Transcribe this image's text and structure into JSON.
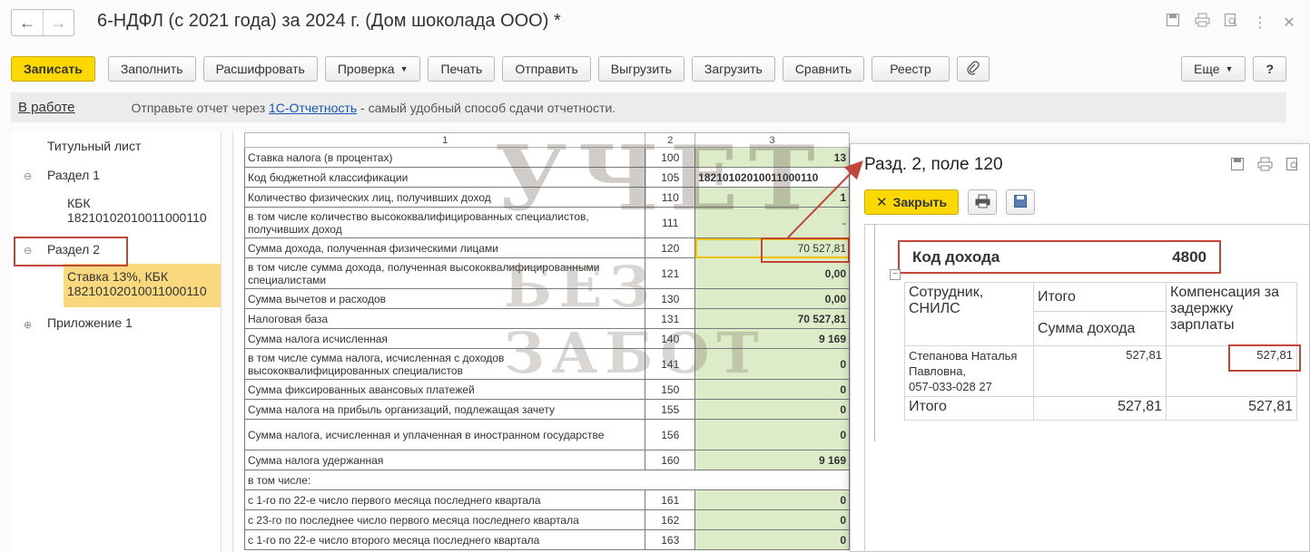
{
  "window": {
    "title": "6-НДФЛ (с 2021 года) за 2024 г. (Дом шоколада ООО) *",
    "back_icon": "←",
    "forward_icon": "→"
  },
  "toolbar": {
    "save": "Записать",
    "fill": "Заполнить",
    "decode": "Расшифровать",
    "check": "Проверка",
    "print": "Печать",
    "send": "Отправить",
    "export": "Выгрузить",
    "import": "Загрузить",
    "compare": "Сравнить",
    "registry": "Реестр",
    "more": "Еще",
    "help": "?"
  },
  "status": {
    "state": "В работе",
    "msg_before": "Отправьте отчет через ",
    "msg_link": "1С-Отчетность",
    "msg_after": " - самый удобный способ сдачи отчетности."
  },
  "tree": {
    "title_sheet": "Титульный лист",
    "section1": "Раздел 1",
    "kbk_line1": "КБК",
    "kbk_line2": "18210102010011000110",
    "section2": "Раздел 2",
    "rate_line1": "Ставка 13%, КБК",
    "rate_line2": "18210102010011000110",
    "appendix1": "Приложение 1"
  },
  "report": {
    "headers": [
      "1",
      "2",
      "3"
    ],
    "rows": [
      {
        "label": "Ставка налога (в процентах)",
        "code": "100",
        "value": "13"
      },
      {
        "label": "Код бюджетной классификации",
        "code": "105",
        "value": "18210102010011000110"
      },
      {
        "label": "Количество физических лиц, получивших доход",
        "code": "110",
        "value": "1"
      },
      {
        "label": "в том числе количество высококвалифицированных специалистов, получивших доход",
        "code": "111",
        "value": "-"
      },
      {
        "label": "Сумма дохода, полученная физическими лицами",
        "code": "120",
        "value": "70 527,81"
      },
      {
        "label": "в том числе сумма дохода, полученная высококвалифицированными специалистами",
        "code": "121",
        "value": "0,00"
      },
      {
        "label": "Сумма вычетов и расходов",
        "code": "130",
        "value": "0,00"
      },
      {
        "label": "Налоговая база",
        "code": "131",
        "value": "70 527,81"
      },
      {
        "label": "Сумма налога исчисленная",
        "code": "140",
        "value": "9 169"
      },
      {
        "label": "в том числе сумма налога, исчисленная с доходов высококвалифицированных специалистов",
        "code": "141",
        "value": "0"
      },
      {
        "label": "Сумма фиксированных авансовых платежей",
        "code": "150",
        "value": "0"
      },
      {
        "label": "Сумма налога на прибыль организаций, подлежащая зачету",
        "code": "155",
        "value": "0"
      },
      {
        "label": "Сумма налога, исчисленная и уплаченная в иностранном государстве",
        "code": "156",
        "value": "0"
      },
      {
        "label": "Сумма налога удержанная",
        "code": "160",
        "value": "9 169"
      },
      {
        "label": "в том числе:",
        "code": "",
        "value": ""
      },
      {
        "label": "с 1-го по 22-е число первого месяца последнего квартала",
        "code": "161",
        "value": "0"
      },
      {
        "label": "с 23-го по последнее число первого месяца последнего квартала",
        "code": "162",
        "value": "0"
      },
      {
        "label": "с 1-го по 22-е число второго месяца последнего квартала",
        "code": "163",
        "value": "0"
      }
    ]
  },
  "popup": {
    "title": "Разд. 2, поле 120",
    "close": "Закрыть",
    "income_code_label": "Код дохода",
    "income_code_value": "4800",
    "col_employee": "Сотрудник, СНИЛС",
    "col_total": "Итого",
    "col_income": "Сумма дохода",
    "col_comp": "Компенсация за задержку зарплаты",
    "employee_name": "Степанова Наталья Павловна,",
    "employee_snils": "057-033-028 27",
    "employee_income": "527,81",
    "employee_comp": "527,81",
    "total_label": "Итого",
    "total_income": "527,81",
    "total_comp": "527,81"
  },
  "watermark": {
    "line1": "УЧЕТ",
    "line2": "БЕЗ ЗАБОТ"
  },
  "colors": {
    "primary_button": "#fbd900",
    "selected_tree": "#f9d87e",
    "value_cell": "#dcebc8",
    "annotation": "#c0463b"
  }
}
